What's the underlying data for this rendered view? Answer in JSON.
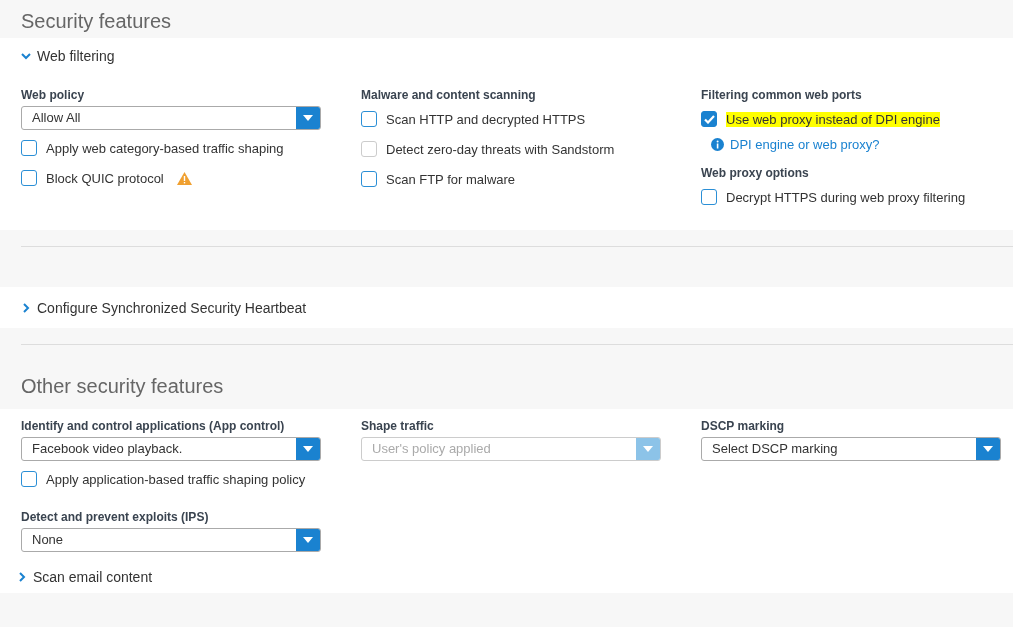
{
  "title": "Security features",
  "web_filtering": {
    "label": "Web filtering",
    "expanded": true,
    "columns": [
      {
        "items": [
          {
            "kind": "heading",
            "text": "Web policy"
          },
          {
            "kind": "select",
            "value": "Allow All",
            "disabled": false
          },
          {
            "kind": "checkbox",
            "label": "Apply web category-based traffic shaping",
            "checked": false,
            "disabled": false,
            "highlighted": false,
            "warning": false
          },
          {
            "kind": "checkbox",
            "label": "Block QUIC protocol",
            "checked": false,
            "disabled": false,
            "highlighted": false,
            "warning": true
          }
        ]
      },
      {
        "items": [
          {
            "kind": "heading",
            "text": "Malware and content scanning"
          },
          {
            "kind": "checkbox",
            "label": "Scan HTTP and decrypted HTTPS",
            "checked": false,
            "disabled": false,
            "highlighted": false,
            "warning": false
          },
          {
            "kind": "checkbox",
            "label": "Detect zero-day threats with Sandstorm",
            "checked": false,
            "disabled": true,
            "highlighted": false,
            "warning": false
          },
          {
            "kind": "checkbox",
            "label": "Scan FTP for malware",
            "checked": false,
            "disabled": false,
            "highlighted": false,
            "warning": false
          }
        ]
      },
      {
        "items": [
          {
            "kind": "heading",
            "text": "Filtering common web ports"
          },
          {
            "kind": "checkbox",
            "label": "Use web proxy instead of DPI engine",
            "checked": true,
            "disabled": false,
            "highlighted": true,
            "warning": false
          },
          {
            "kind": "link",
            "text": "DPI engine or web proxy?"
          },
          {
            "kind": "heading",
            "text": "Web proxy options"
          },
          {
            "kind": "checkbox",
            "label": "Decrypt HTTPS during web proxy filtering",
            "checked": false,
            "disabled": false,
            "highlighted": false,
            "warning": false
          }
        ]
      }
    ]
  },
  "heartbeat": {
    "label": "Configure Synchronized Security Heartbeat",
    "expanded": false
  },
  "other": {
    "title": "Other security features",
    "columns": [
      {
        "items": [
          {
            "kind": "heading",
            "text": "Identify and control applications (App control)"
          },
          {
            "kind": "select",
            "value": "Facebook video playback.",
            "disabled": false
          },
          {
            "kind": "checkbox",
            "label": "Apply application-based traffic shaping policy",
            "checked": false,
            "disabled": false,
            "highlighted": false,
            "warning": false
          },
          {
            "kind": "heading",
            "text": "Detect and prevent exploits (IPS)"
          },
          {
            "kind": "select",
            "value": "None",
            "disabled": false
          }
        ]
      },
      {
        "items": [
          {
            "kind": "heading",
            "text": "Shape traffic"
          },
          {
            "kind": "select",
            "value": "User's policy applied",
            "disabled": true
          }
        ]
      },
      {
        "items": [
          {
            "kind": "heading",
            "text": "DSCP marking"
          },
          {
            "kind": "select",
            "value": "Select DSCP marking",
            "disabled": false
          }
        ]
      }
    ],
    "email": {
      "label": "Scan email content",
      "expanded": false
    }
  }
}
